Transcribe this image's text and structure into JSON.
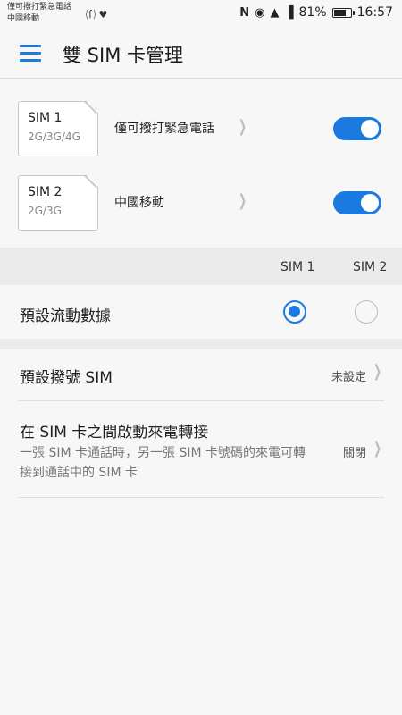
{
  "status_bar": {
    "carrier_line1": "僅可撥打緊急電話",
    "carrier_line2": "中國移動",
    "extra_icons": "⒡ ♥",
    "nfc_icon": "N",
    "eye_icon": "◉",
    "wifi_icon": "▲",
    "signal_icon": "▐",
    "battery_percent": "81%",
    "battery_level": 0.81,
    "time": "16:57"
  },
  "toolbar": {
    "menu_icon": "hamburger-menu-icon",
    "title": "雙 SIM 卡管理"
  },
  "sims": [
    {
      "name": "SIM 1",
      "type": "2G/3G/4G",
      "label": "僅可撥打緊急電話",
      "enabled": true
    },
    {
      "name": "SIM 2",
      "type": "2G/3G",
      "label": "中國移動",
      "enabled": true
    }
  ],
  "data_section": {
    "col_sim1": "SIM 1",
    "col_sim2": "SIM 2",
    "label": "預設流動數據",
    "selected": "SIM 1"
  },
  "default_call": {
    "title": "預設撥號 SIM",
    "value": "未設定"
  },
  "forwarding": {
    "title": "在 SIM 卡之間啟動來電轉接",
    "subtitle": "一張 SIM 卡通話時，另一張 SIM 卡號碼的來電可轉接到通話中的 SIM 卡",
    "value": "關閉"
  },
  "chevron_glyph": "❯",
  "colors": {
    "accent": "#1a7ae0",
    "background": "#f7f7f7",
    "band": "#ebebeb"
  }
}
